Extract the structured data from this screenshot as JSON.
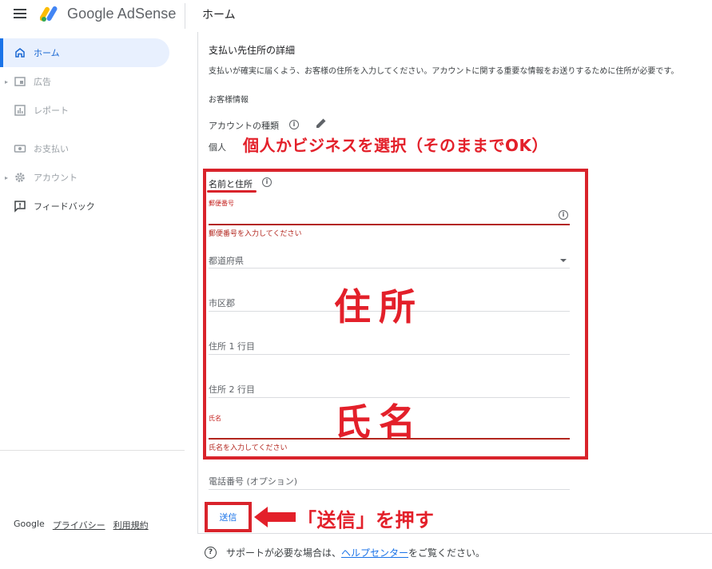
{
  "header": {
    "brand": "Google AdSense",
    "page_title": "ホーム"
  },
  "sidebar": {
    "items": [
      {
        "label": "ホーム",
        "icon": "home-icon",
        "state": "active"
      },
      {
        "label": "広告",
        "icon": "ads-icon",
        "state": "disabled",
        "expandable": true
      },
      {
        "label": "レポート",
        "icon": "reports-icon",
        "state": "disabled"
      },
      {
        "label": "お支払い",
        "icon": "payments-icon",
        "state": "disabled"
      },
      {
        "label": "アカウント",
        "icon": "gear-icon",
        "state": "disabled",
        "expandable": true
      },
      {
        "label": "フィードバック",
        "icon": "feedback-icon",
        "state": "normal"
      }
    ],
    "footer": {
      "google": "Google",
      "privacy": "プライバシー",
      "terms": "利用規約"
    }
  },
  "form": {
    "title": "支払い先住所の詳細",
    "description": "支払いが確実に届くよう、お客様の住所を入力してください。アカウントに関する重要な情報をお送りするために住所が必要です。",
    "customer_info": "お客様情報",
    "account_type_label": "アカウントの種類",
    "account_type_value": "個人",
    "name_address_label": "名前と住所",
    "postal_code_label": "郵便番号",
    "postal_code_error": "郵便番号を入力してください",
    "prefecture_label": "都道府県",
    "city_label": "市区郡",
    "address1_label": "住所 1 行目",
    "address2_label": "住所 2 行目",
    "name_label": "氏名",
    "name_error": "氏名を入力してください",
    "phone_label": "電話番号 (オプション)",
    "submit_label": "送信"
  },
  "support": {
    "prefix": "サポートが必要な場合は、",
    "link": "ヘルプセンター",
    "suffix": "をご覧ください。"
  },
  "annotations": {
    "account_type": "個人かビジネスを選択（そのままでOK）",
    "address": "住所",
    "name": "氏名",
    "submit": "「送信」を押す"
  },
  "colors": {
    "accent": "#1a73e8",
    "annotation_red": "#e3202a",
    "error_red": "#b3261e"
  }
}
